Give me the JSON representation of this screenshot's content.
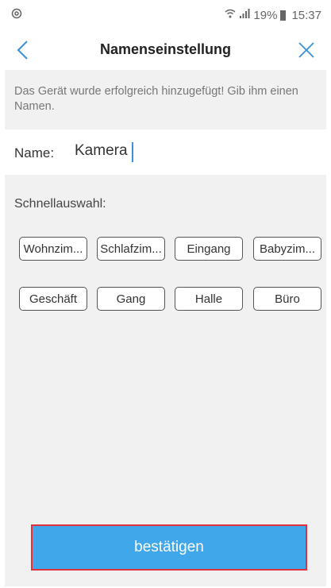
{
  "status_bar": {
    "left_icon": "app-notification-icon",
    "battery_percent": "19%",
    "time": "15:37"
  },
  "header": {
    "title": "Namenseinstellung",
    "back_icon": "chevron-left-icon",
    "close_icon": "close-icon",
    "accent_color": "#3a8fd8"
  },
  "notice": {
    "text": "Das Gerät wurde erfolgreich hinzugefügt! Gib ihm einen Namen."
  },
  "name_field": {
    "label": "Name:",
    "value": "Kamera"
  },
  "quick_select": {
    "label": "Schnellauswahl:",
    "chips": [
      "Wohnzim...",
      "Schlafzim...",
      "Eingang",
      "Babyzim...",
      "Geschäft",
      "Gang",
      "Halle",
      "Büro"
    ]
  },
  "confirm_button": {
    "label": "bestätigen",
    "color": "#40a7ea"
  }
}
